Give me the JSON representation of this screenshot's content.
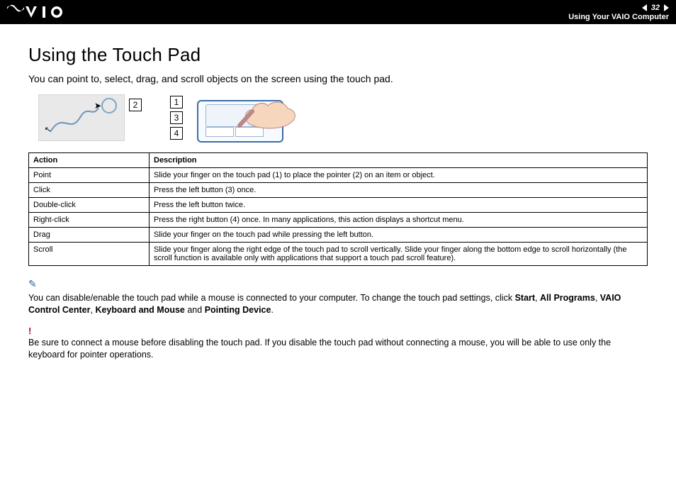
{
  "header": {
    "page_number": "32",
    "section_title": "Using Your VAIO Computer"
  },
  "title": "Using the Touch Pad",
  "intro": "You can point to, select, drag, and scroll objects on the screen using the touch pad.",
  "labels": {
    "l1": "1",
    "l2": "2",
    "l3": "3",
    "l4": "4"
  },
  "table": {
    "head_action": "Action",
    "head_desc": "Description",
    "rows": [
      {
        "a": "Point",
        "d": "Slide your finger on the touch pad (1) to place the pointer (2) on an item or object."
      },
      {
        "a": "Click",
        "d": "Press the left button (3) once."
      },
      {
        "a": "Double-click",
        "d": "Press the left button twice."
      },
      {
        "a": "Right-click",
        "d": "Press the right button (4) once. In many applications, this action displays a shortcut menu."
      },
      {
        "a": "Drag",
        "d": "Slide your finger on the touch pad while pressing the left button."
      },
      {
        "a": "Scroll",
        "d": "Slide your finger along the right edge of the touch pad to scroll vertically. Slide your finger along the bottom edge to scroll horizontally (the scroll function is available only with applications that support a touch pad scroll feature)."
      }
    ]
  },
  "note": {
    "pre": "You can disable/enable the touch pad while a mouse is connected to your computer. To change the touch pad settings, click ",
    "b1": "Start",
    "s1": ", ",
    "b2": "All Programs",
    "s2": ", ",
    "b3": "VAIO Control Center",
    "s3": ", ",
    "b4": "Keyboard and Mouse",
    "s4": " and ",
    "b5": "Pointing Device",
    "post": "."
  },
  "warning": "Be sure to connect a mouse before disabling the touch pad. If you disable the touch pad without connecting a mouse, you will be able to use only the keyboard for pointer operations."
}
